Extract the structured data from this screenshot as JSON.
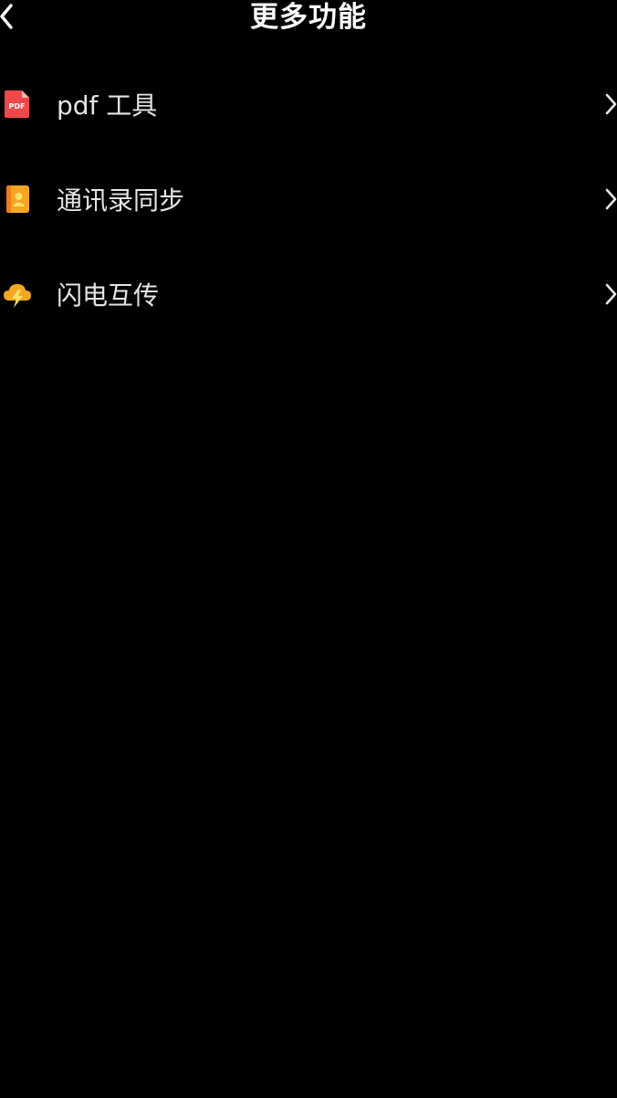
{
  "header": {
    "title": "更多功能",
    "back_icon": "chevron-left-icon"
  },
  "items": [
    {
      "label": "pdf 工具",
      "icon": "pdf-icon",
      "icon_text": "PDF",
      "accent": "#f04848"
    },
    {
      "label": "通讯录同步",
      "icon": "contacts-icon",
      "accent": "#f5a623"
    },
    {
      "label": "闪电互传",
      "icon": "lightning-cloud-icon",
      "accent": "#f5a623"
    }
  ],
  "colors": {
    "background": "#000000",
    "text": "#e6e6e6",
    "title": "#ffffff"
  }
}
